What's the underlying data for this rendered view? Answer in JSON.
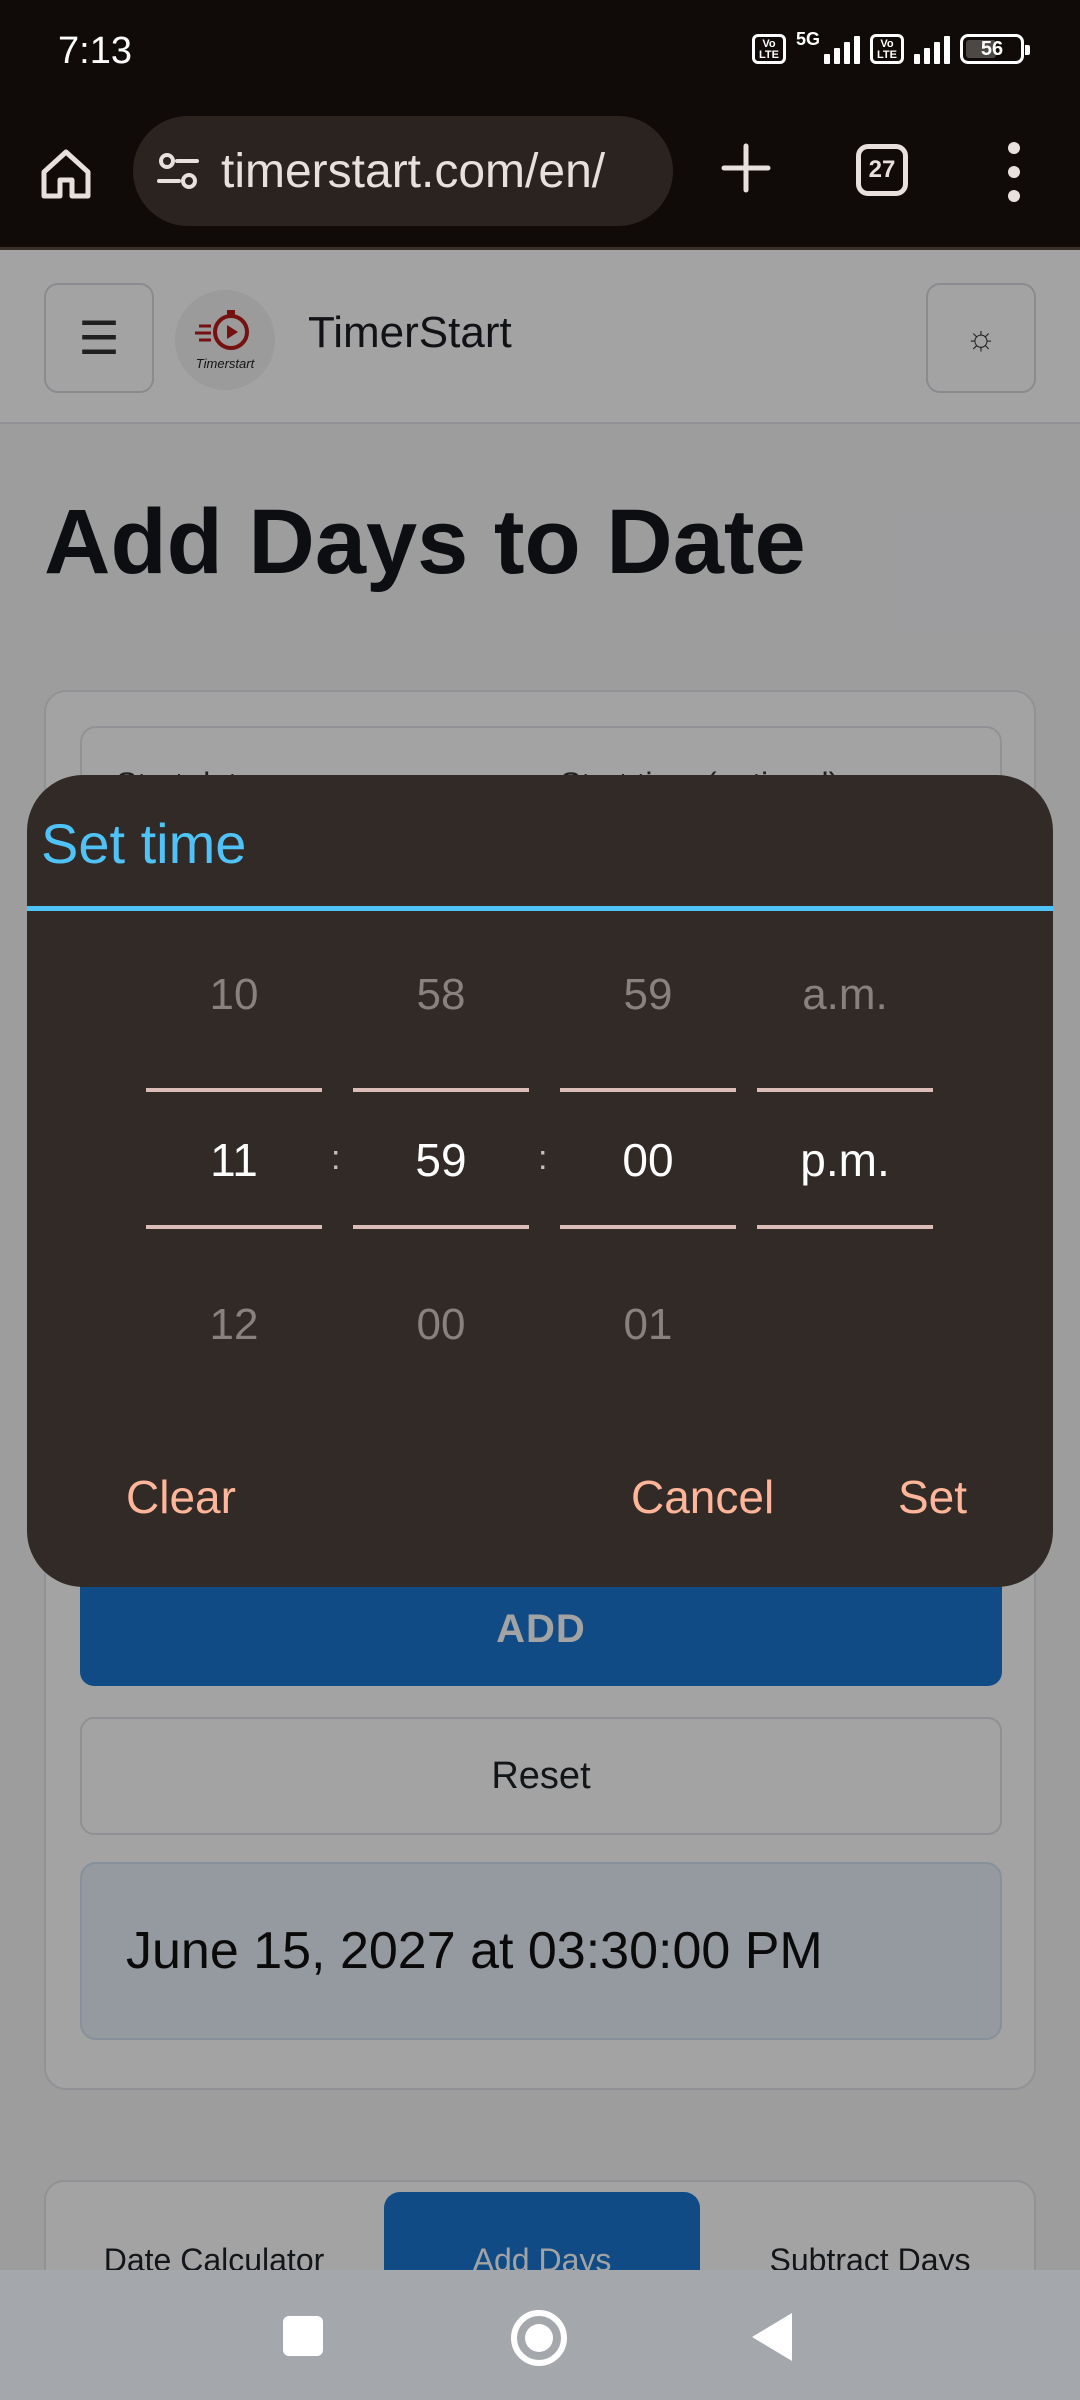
{
  "status_bar": {
    "time": "7:13",
    "network": "5G",
    "volte_label": "Vo LTE",
    "battery": "56"
  },
  "browser": {
    "url": "timerstart.com/en/",
    "tab_count": "27",
    "icons": [
      "home-icon",
      "site-settings-icon",
      "new-tab-icon",
      "tabs-icon",
      "more-menu-icon"
    ]
  },
  "site": {
    "name": "TimerStart",
    "logo_text": "Timerstart",
    "menu_glyph": "☰",
    "theme_glyph": "☼"
  },
  "page": {
    "title": "Add Days to Date",
    "start_date_label": "Start date",
    "start_time_label": "Start time (optional)",
    "add_button": "ADD",
    "reset_button": "Reset",
    "result": "June 15, 2027 at 03:30:00 PM"
  },
  "bottom_tabs": [
    {
      "label": "Date Calculator",
      "active": false
    },
    {
      "label": "Add Days",
      "active": true
    },
    {
      "label": "Subtract Days",
      "active": false
    }
  ],
  "time_dialog": {
    "title": "Set time",
    "hour": {
      "prev": "10",
      "selected": "11",
      "next": "12"
    },
    "minute": {
      "prev": "58",
      "selected": "59",
      "next": "00"
    },
    "second": {
      "prev": "59",
      "selected": "00",
      "next": "01"
    },
    "period": {
      "prev": "a.m.",
      "selected": "p.m."
    },
    "separator": ":",
    "clear_button": "Clear",
    "cancel_button": "Cancel",
    "set_button": "Set"
  },
  "colors": {
    "accent": "#4fc3f7",
    "dialog_bg": "#322a26",
    "dialog_action": "#ffb599",
    "primary_button": "#1976d2"
  }
}
